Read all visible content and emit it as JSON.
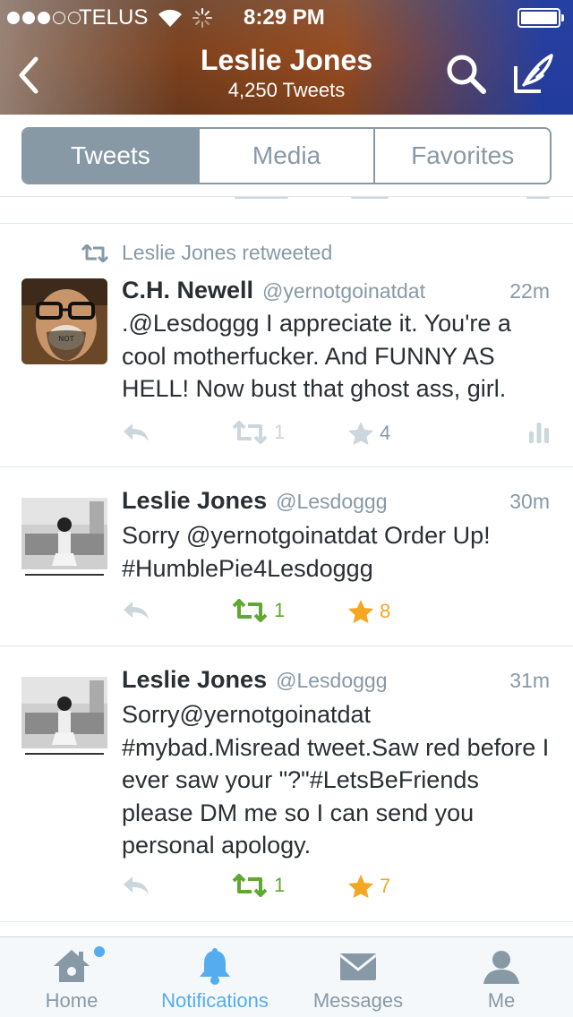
{
  "status_bar": {
    "carrier": "TELUS",
    "time": "8:29 PM"
  },
  "header": {
    "name": "Leslie Jones",
    "tweet_count": "4,250 Tweets"
  },
  "segments": {
    "tweets": "Tweets",
    "media": "Media",
    "favorites": "Favorites",
    "selected": "Tweets"
  },
  "tweets": [
    {
      "retweet_note": "Leslie Jones retweeted",
      "name": "C.H. Newell",
      "handle": "@yernotgoinatdat",
      "time": "22m",
      "text": ".@Lesdoggg I appreciate it. You're a cool motherfucker. And FUNNY AS HELL! Now bust that ghost ass, girl.",
      "retweets": "1",
      "favorites": "4",
      "retweeted": false,
      "favorited": false
    },
    {
      "name": "Leslie Jones",
      "handle": "@Lesdoggg",
      "time": "30m",
      "text": "Sorry @yernotgoinatdat Order Up! #HumblePie4Lesdoggg",
      "retweets": "1",
      "favorites": "8",
      "retweeted": true,
      "favorited": true
    },
    {
      "name": "Leslie Jones",
      "handle": "@Lesdoggg",
      "time": "31m",
      "text": "Sorry@yernotgoinatdat #mybad.Misread tweet.Saw red before I ever saw your \"?\"#LetsBeFriends please DM me so I can send you personal apology.",
      "retweets": "1",
      "favorites": "7",
      "retweeted": true,
      "favorited": true
    }
  ],
  "tabbar": {
    "home": "Home",
    "notifications": "Notifications",
    "messages": "Messages",
    "me": "Me",
    "active": "Notifications"
  },
  "colors": {
    "accent_blue": "#55acee",
    "retweet_green": "#5fa832",
    "favorite_orange": "#f5a623",
    "muted_gray": "#8899a6"
  }
}
